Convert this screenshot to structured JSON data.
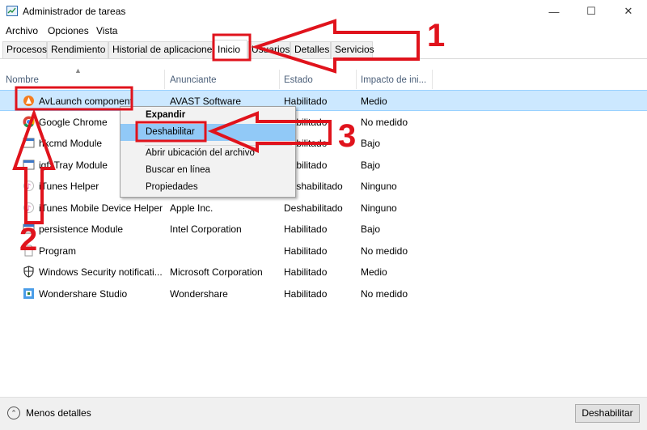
{
  "window": {
    "title": "Administrador de tareas",
    "icon": "task-manager-icon",
    "minimize_glyph": "—",
    "maximize_glyph": "☐",
    "close_glyph": "✕"
  },
  "menu": [
    "Archivo",
    "Opciones",
    "Vista"
  ],
  "tabs": [
    {
      "label": "Procesos",
      "active": false
    },
    {
      "label": "Rendimiento",
      "active": false
    },
    {
      "label": "Historial de aplicaciones",
      "active": false
    },
    {
      "label": "Inicio",
      "active": true
    },
    {
      "label": "Usuarios",
      "active": false
    },
    {
      "label": "Detalles",
      "active": false
    },
    {
      "label": "Servicios",
      "active": false
    }
  ],
  "columns": {
    "name": "Nombre",
    "publisher": "Anunciante",
    "status": "Estado",
    "impact": "Impacto de ini..."
  },
  "rows": [
    {
      "name": "AvLaunch component",
      "publisher": "AVAST Software",
      "status": "Habilitado",
      "impact": "Medio",
      "icon": "avast-icon",
      "selected": true
    },
    {
      "name": "Google Chrome",
      "publisher": "",
      "status": "Habilitado",
      "impact": "No medido",
      "icon": "chrome-icon",
      "selected": false
    },
    {
      "name": "hkcmd Module",
      "publisher": "",
      "status": "Habilitado",
      "impact": "Bajo",
      "icon": "app-window-icon",
      "selected": false
    },
    {
      "name": "igfxTray Module",
      "publisher": "",
      "status": "Habilitado",
      "impact": "Bajo",
      "icon": "app-window-icon",
      "selected": false
    },
    {
      "name": "iTunes Helper",
      "publisher": "",
      "status": "Deshabilitado",
      "impact": "Ninguno",
      "icon": "itunes-icon",
      "selected": false
    },
    {
      "name": "iTunes Mobile Device Helper",
      "publisher": "Apple Inc.",
      "status": "Deshabilitado",
      "impact": "Ninguno",
      "icon": "itunes-icon",
      "selected": false
    },
    {
      "name": "persistence Module",
      "publisher": "Intel Corporation",
      "status": "Habilitado",
      "impact": "Bajo",
      "icon": "app-window-icon",
      "selected": false
    },
    {
      "name": "Program",
      "publisher": "",
      "status": "Habilitado",
      "impact": "No medido",
      "icon": "blank-file-icon",
      "selected": false
    },
    {
      "name": "Windows Security notificati...",
      "publisher": "Microsoft Corporation",
      "status": "Habilitado",
      "impact": "Medio",
      "icon": "shield-icon",
      "selected": false
    },
    {
      "name": "Wondershare Studio",
      "publisher": "Wondershare",
      "status": "Habilitado",
      "impact": "No medido",
      "icon": "wondershare-icon",
      "selected": false
    }
  ],
  "context_menu": [
    {
      "label": "Expandir",
      "bold": true,
      "highlighted": false
    },
    {
      "label": "Deshabilitar",
      "bold": false,
      "highlighted": true
    },
    {
      "label": "Abrir ubicación del archivo",
      "bold": false,
      "highlighted": false
    },
    {
      "label": "Buscar en línea",
      "bold": false,
      "highlighted": false
    },
    {
      "label": "Propiedades",
      "bold": false,
      "highlighted": false
    }
  ],
  "footer": {
    "fewer_details": "Menos detalles",
    "disable_button": "Deshabilitar"
  },
  "annotations": {
    "color": "#e0131c",
    "step1": "1",
    "step2": "2",
    "step3": "3"
  },
  "colors": {
    "selected_row": "#cce8ff",
    "menu_highlight": "#91c9f7",
    "header_text": "#4c607a"
  }
}
